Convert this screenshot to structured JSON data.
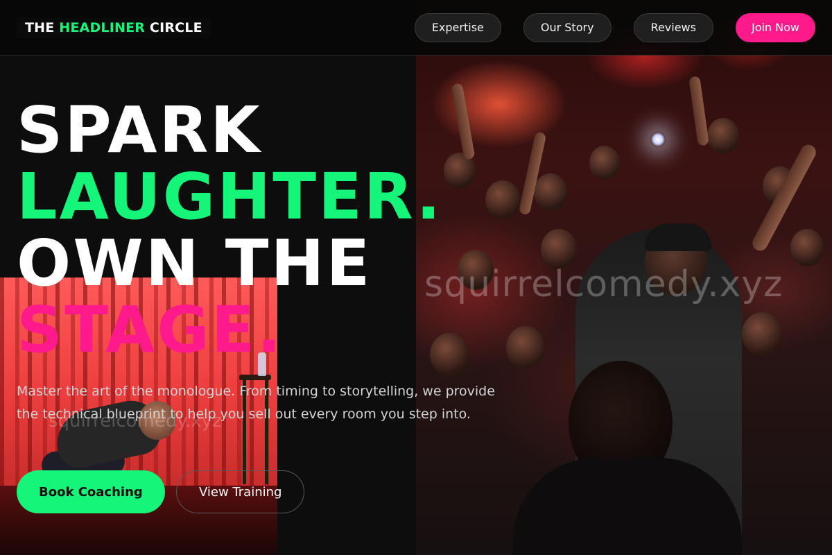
{
  "header": {
    "logo_prefix": "THE ",
    "logo_accent": "HEADLINER",
    "logo_suffix": " CIRCLE",
    "nav": [
      "Expertise",
      "Our Story",
      "Reviews"
    ],
    "join_label": "Join Now"
  },
  "hero": {
    "line1": "SPARK",
    "line2": "LAUGHTER.",
    "line3": "OWN THE",
    "line4": "STAGE.",
    "subtitle": "Master the art of the monologue. From timing to storytelling, we provide the technical blueprint to help you sell out every room you step into.",
    "primary_cta": "Book Coaching",
    "secondary_cta": "View Training"
  },
  "watermark": "squirrelcomedy.xyz",
  "colors": {
    "background": "#0d0d0d",
    "green_accent": "#14f57a",
    "pink_accent": "#ff1a8c"
  }
}
